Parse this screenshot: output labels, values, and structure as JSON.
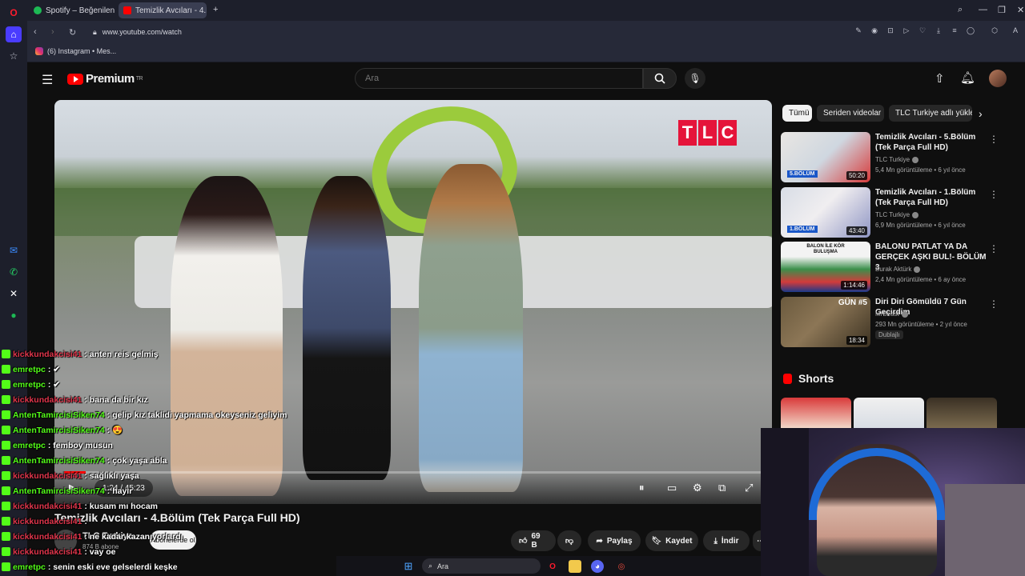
{
  "browser": {
    "tabs": [
      {
        "label": "Spotify – Beğenilen Şarkıl",
        "color": "#1db954"
      },
      {
        "label": "Temizlik Avcıları - 4.Bö",
        "color": "#ff0000"
      }
    ],
    "url": "www.youtube.com/watch",
    "bookmark": "(6) Instagram • Mes..."
  },
  "youtube": {
    "logo_text": "Premium",
    "logo_region": "TR",
    "search_placeholder": "Ara"
  },
  "video": {
    "channel_watermark": [
      "T",
      "L",
      "C"
    ],
    "time": "1:24 / 45:23",
    "progress": 0.031,
    "title": "Temizlik Avcıları - 4.Bölüm (Tek Parça Full HD)",
    "channel": "TLC Turkiye",
    "subscribers": "874 B abone",
    "subscribe_label": "Abonelerde ol",
    "likes": "69 B",
    "share": "Paylaş",
    "save": "Kaydet",
    "download": "İndir"
  },
  "chips": [
    "Tümü",
    "Seriden videolar",
    "TLC Turkiye adlı yükle"
  ],
  "recommendations": [
    {
      "title": "Temizlik Avcıları - 5.Bölüm (Tek Parça Full HD)",
      "channel": "TLC Turkiye",
      "meta": "5,4 Mn görüntüleme • 6 yıl önce",
      "duration": "50:20",
      "thumb_label": "5.BÖLÜM"
    },
    {
      "title": "Temizlik Avcıları - 1.Bölüm (Tek Parça Full HD)",
      "channel": "TLC Turkiye",
      "meta": "6,9 Mn görüntüleme • 6 yıl önce",
      "duration": "43:40",
      "thumb_label": "1.BÖLÜM"
    },
    {
      "title": "BALONU PATLAT YA DA GERÇEK AŞKI BUL!- BÖLÜM 3",
      "channel": "Burak Aktürk",
      "meta": "2,4 Mn görüntüleme • 6 ay önce",
      "duration": "1:14:46",
      "thumb_label": "BALON İLE KÖR BULUŞMA"
    },
    {
      "title": "Diri Diri Gömüldü 7 Gün Geçirdim",
      "channel": "MrBeast",
      "meta": "293 Mn görüntüleme • 2 yıl önce",
      "duration": "18:34",
      "thumb_label": "GÜN #5",
      "badge": "Dublajlı"
    }
  ],
  "shorts_title": "Shorts",
  "chat": [
    {
      "user": "kickkundakcisi41",
      "msg": ": anten reis gelmiş",
      "color": "#e0354b"
    },
    {
      "user": "emretpc",
      "msg": ": ✔",
      "color": "#53fc18"
    },
    {
      "user": "emretpc",
      "msg": ": ✔",
      "color": "#53fc18"
    },
    {
      "user": "kickkundakcisi41",
      "msg": ": bana da bir kız",
      "color": "#e0354b"
    },
    {
      "user": "AntenTamircisiSiken74",
      "msg": ": gelip kız taklidi yapmama okeyseniz geliyim",
      "color": "#53fc18"
    },
    {
      "user": "AntenTamircisiSiken74",
      "msg": ": 😍",
      "color": "#53fc18"
    },
    {
      "user": "emretpc",
      "msg": ": femboy musun",
      "color": "#53fc18"
    },
    {
      "user": "AntenTamircisiSiken74",
      "msg": ": çok yaşa abla",
      "color": "#53fc18"
    },
    {
      "user": "kickkundakcisi41",
      "msg": ": sağlıklı yaşa",
      "color": "#e0354b"
    },
    {
      "user": "AntenTamircisiSiken74",
      "msg": ": hayır",
      "color": "#53fc18"
    },
    {
      "user": "kickkundakcisi41",
      "msg": ": kusam mı hocam",
      "color": "#e0354b"
    },
    {
      "user": "kickkundakcisi41",
      "msg": ":",
      "color": "#e0354b"
    },
    {
      "user": "kickkundakcisi41",
      "msg": ": ne kadar kazanıyorlardı",
      "color": "#e0354b"
    },
    {
      "user": "kickkundakcisi41",
      "msg": ": vay oe",
      "color": "#e0354b"
    },
    {
      "user": "emretpc",
      "msg": ": senin eski eve gelselerdi keşke",
      "color": "#53fc18"
    }
  ],
  "taskbar": {
    "search": "Ara"
  }
}
